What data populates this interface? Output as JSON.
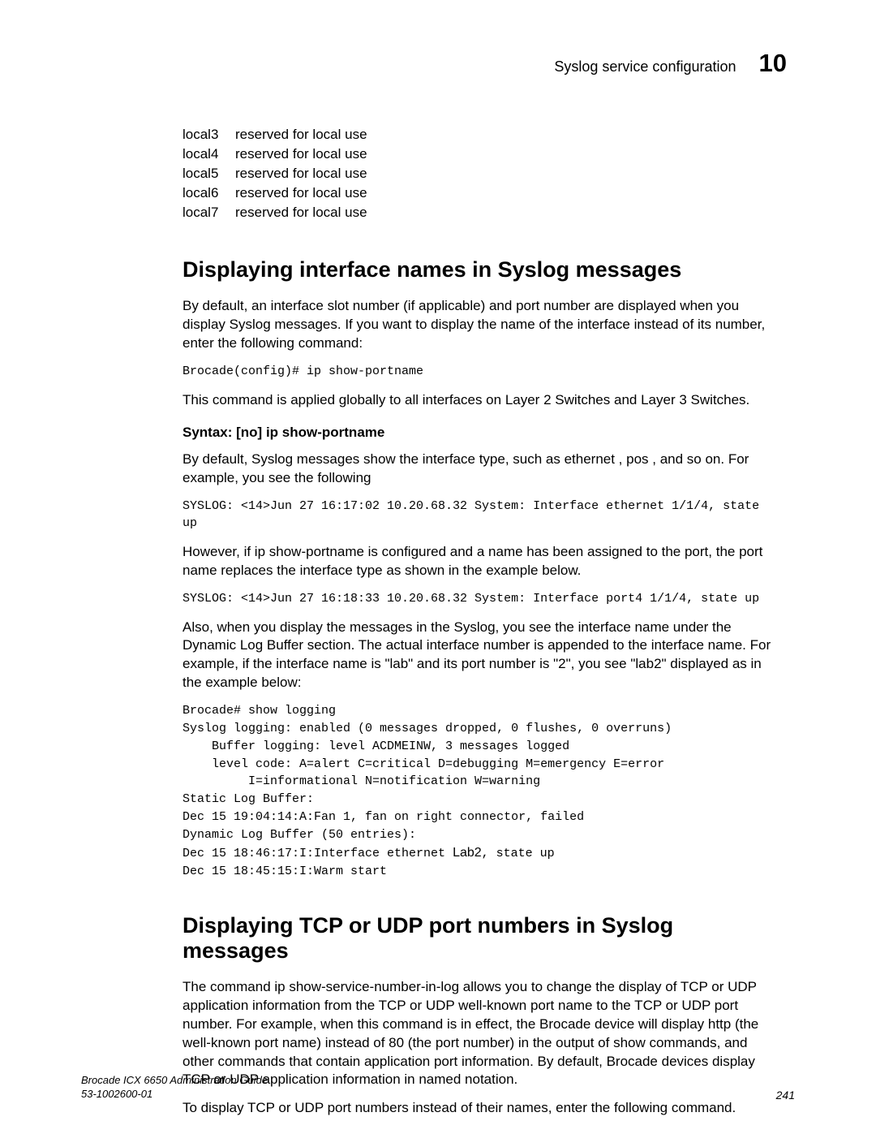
{
  "header": {
    "title": "Syslog service configuration",
    "chapter": "10"
  },
  "facilities": [
    {
      "name": "local3",
      "desc": "reserved for local use"
    },
    {
      "name": "local4",
      "desc": "reserved for local use"
    },
    {
      "name": "local5",
      "desc": "reserved for local use"
    },
    {
      "name": "local6",
      "desc": "reserved for local use"
    },
    {
      "name": "local7",
      "desc": "reserved for local use"
    }
  ],
  "section1": {
    "heading": "Displaying interface names in Syslog messages",
    "p1": "By default, an interface slot number (if applicable) and port number are displayed when you display Syslog messages. If you want to display the name of the interface instead of its number, enter the following command:",
    "code1": "Brocade(config)# ip show-portname",
    "p2": "This command is applied globally to all interfaces on Layer 2 Switches and Layer 3 Switches.",
    "syntax": "Syntax: [no] ip show-portname",
    "p3": "By default, Syslog messages show the interface type, such as  ethernet ,  pos , and so on. For example, you see the following",
    "code2": "SYSLOG: <14>Jun 27 16:17:02 10.20.68.32 System: Interface ethernet 1/1/4, state up",
    "p4": "However, if ip show-portname is configured and a name has been assigned to the port, the port name replaces the interface type as shown in the example below.",
    "code3": "SYSLOG: <14>Jun 27 16:18:33 10.20.68.32 System: Interface port4 1/1/4, state up",
    "p5": "Also, when you display the messages in the Syslog, you see the interface name under the Dynamic Log Buffer section. The actual interface number is appended to the interface name.  For example, if the interface name is \"lab\" and its port number is \"2\", you see \"lab2\" displayed as in the example below:",
    "log": {
      "l1": "Brocade# show logging",
      "l2": "Syslog logging: enabled (0 messages dropped, 0 flushes, 0 overruns)",
      "l3": "    Buffer logging: level ACDMEINW, 3 messages logged",
      "l4": "    level code: A=alert C=critical D=debugging M=emergency E=error",
      "l5": "         I=informational N=notification W=warning",
      "l6": "Static Log Buffer:",
      "l7": "Dec 15 19:04:14:A:Fan 1, fan on right connector, failed",
      "l8": "Dynamic Log Buffer (50 entries):",
      "l9a": "Dec 15 18:46:17:I:Interface ethernet ",
      "l9b": "Lab2",
      "l9c": ", state up",
      "l10": "Dec 15 18:45:15:I:Warm start"
    }
  },
  "section2": {
    "heading": "Displaying TCP or UDP port numbers in Syslog messages",
    "p1": "The command ip show-service-number-in-log allows you to change the display of TCP or UDP application information from the TCP or UDP well-known port name to the TCP or UDP port number. For example, when this command is in effect, the Brocade device will display http (the well-known port name) instead of 80 (the port number) in the output of show commands, and other commands that contain application port information. By default, Brocade devices display TCP or UDP application information in named notation.",
    "p2": "To display TCP or UDP port numbers instead of their names, enter the following command."
  },
  "footer": {
    "guide": "Brocade ICX 6650 Administration Guide",
    "docnum": "53-1002600-01",
    "page": "241"
  }
}
